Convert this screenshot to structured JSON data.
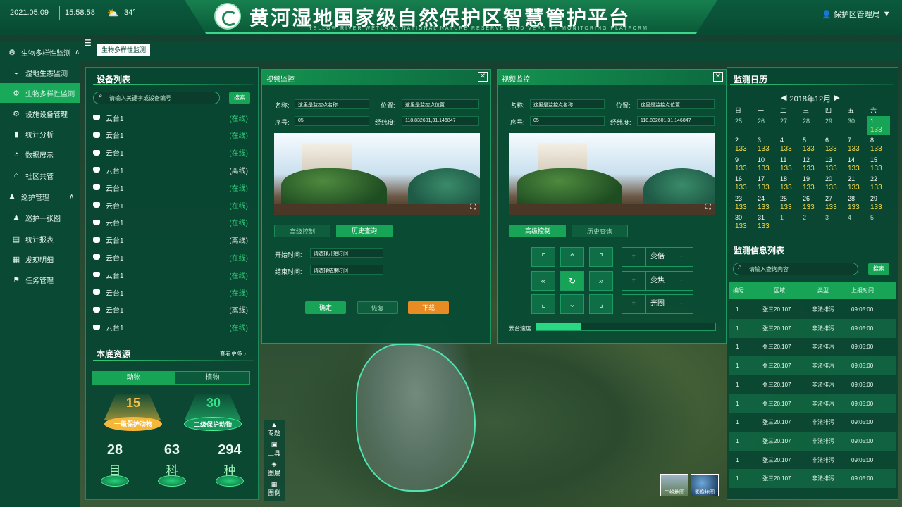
{
  "header": {
    "date": "2021.05.09",
    "time": "15:58:58",
    "temperature": "34°",
    "title": "黄河湿地国家级自然保护区智慧管护平台",
    "subtitle": "YELLOW RIVER WETLAND NATIONAL NATURE RESERVE BIODIVERSITY MONITORING PLATFORM",
    "user": "保护区管理局"
  },
  "breadcrumb": "生物多样性监测",
  "sidebar": {
    "sections": [
      {
        "label": "生物多样性监测",
        "items": [
          "湿地生态监测",
          "生物多样性监测",
          "设施设备管理",
          "统计分析",
          "数据展示",
          "社区共管"
        ]
      },
      {
        "label": "巡护管理",
        "items": [
          "巡护一张图",
          "统计报表",
          "发现明细",
          "任务管理"
        ]
      }
    ]
  },
  "devices": {
    "title": "设备列表",
    "search_placeholder": "请输入关键字或设备编号",
    "search_btn": "搜索",
    "rows": [
      {
        "name": "云台1",
        "status": "(在线)"
      },
      {
        "name": "云台1",
        "status": "(在线)"
      },
      {
        "name": "云台1",
        "status": "(在线)"
      },
      {
        "name": "云台1",
        "status": "(离线)"
      },
      {
        "name": "云台1",
        "status": "(在线)"
      },
      {
        "name": "云台1",
        "status": "(在线)"
      },
      {
        "name": "云台1",
        "status": "(在线)"
      },
      {
        "name": "云台1",
        "status": "(离线)"
      },
      {
        "name": "云台1",
        "status": "(在线)"
      },
      {
        "name": "云台1",
        "status": "(在线)"
      },
      {
        "name": "云台1",
        "status": "(在线)"
      },
      {
        "name": "云台1",
        "status": "(离线)"
      },
      {
        "name": "云台1",
        "status": "(在线)"
      }
    ]
  },
  "resources": {
    "title": "本底资源",
    "more": "查看更多",
    "tabs": [
      "动物",
      "植物"
    ],
    "level1": {
      "value": "15",
      "label": "一级保护动物"
    },
    "level2": {
      "value": "30",
      "label": "二级保护动物"
    },
    "stats": [
      {
        "value": "28",
        "unit": "目"
      },
      {
        "value": "63",
        "unit": "科"
      },
      {
        "value": "294",
        "unit": "种"
      }
    ]
  },
  "video1": {
    "title": "视频监控",
    "name_label": "名称:",
    "name_value": "这里是监控点名称",
    "pos_label": "位置:",
    "pos_value": "这里是监控点位置",
    "seq_label": "序号:",
    "seq_value": "05",
    "coord_label": "经纬度:",
    "coord_value": "118.832601,31.146847",
    "tab_adv": "高级控制",
    "tab_hist": "历史查询",
    "start_label": "开始时间:",
    "start_ph": "请选择开始时间",
    "end_label": "结束时间:",
    "end_ph": "请选择结束时间",
    "ok": "确定",
    "reset": "恢复",
    "download": "下载"
  },
  "video2": {
    "title": "视频监控",
    "name_label": "名称:",
    "name_value": "这里是监控点名称",
    "pos_label": "位置:",
    "pos_value": "这里是监控点位置",
    "seq_label": "序号:",
    "seq_value": "05",
    "coord_label": "经纬度:",
    "coord_value": "118.832601,31.146847",
    "tab_adv": "高级控制",
    "tab_hist": "历史查询",
    "zoom": "变倍",
    "focus": "变焦",
    "iris": "光圈",
    "speed_label": "云台速度",
    "speed": 0.25
  },
  "tools": [
    "专题",
    "工具",
    "图层",
    "图例"
  ],
  "basemap": [
    "三维地图",
    "影像地图"
  ],
  "calendar": {
    "title": "监测日历",
    "month": "2018年12月",
    "weekdays": [
      "日",
      "一",
      "二",
      "三",
      "四",
      "五",
      "六"
    ],
    "rows": [
      [
        [
          "25",
          ""
        ],
        [
          "26",
          ""
        ],
        [
          "27",
          ""
        ],
        [
          "28",
          ""
        ],
        [
          "29",
          ""
        ],
        [
          "30",
          ""
        ],
        [
          "1",
          "133"
        ]
      ],
      [
        [
          "2",
          "133"
        ],
        [
          "3",
          "133"
        ],
        [
          "4",
          "133"
        ],
        [
          "5",
          "133"
        ],
        [
          "6",
          "133"
        ],
        [
          "7",
          "133"
        ],
        [
          "8",
          "133"
        ]
      ],
      [
        [
          "9",
          "133"
        ],
        [
          "10",
          "133"
        ],
        [
          "11",
          "133"
        ],
        [
          "12",
          "133"
        ],
        [
          "13",
          "133"
        ],
        [
          "14",
          "133"
        ],
        [
          "15",
          "133"
        ]
      ],
      [
        [
          "16",
          "133"
        ],
        [
          "17",
          "133"
        ],
        [
          "18",
          "133"
        ],
        [
          "19",
          "133"
        ],
        [
          "20",
          "133"
        ],
        [
          "21",
          "133"
        ],
        [
          "22",
          "133"
        ]
      ],
      [
        [
          "23",
          "133"
        ],
        [
          "24",
          "133"
        ],
        [
          "25",
          "133"
        ],
        [
          "26",
          "133"
        ],
        [
          "27",
          "133"
        ],
        [
          "28",
          "133"
        ],
        [
          "29",
          "133"
        ]
      ],
      [
        [
          "30",
          "133"
        ],
        [
          "31",
          "133"
        ],
        [
          "1",
          ""
        ],
        [
          "2",
          ""
        ],
        [
          "3",
          ""
        ],
        [
          "4",
          ""
        ],
        [
          "5",
          ""
        ]
      ]
    ]
  },
  "monitor": {
    "title": "监测信息列表",
    "search_placeholder": "请输入查询内容",
    "search_btn": "搜索",
    "columns": [
      "编号",
      "区域",
      "类型",
      "上报时间"
    ],
    "rows": [
      [
        "1",
        "张三20.107",
        "非法排污",
        "09:05:00"
      ],
      [
        "1",
        "张三20.107",
        "非法排污",
        "09:05:00"
      ],
      [
        "1",
        "张三20.107",
        "非法排污",
        "09:05:00"
      ],
      [
        "1",
        "张三20.107",
        "非法排污",
        "09:05:00"
      ],
      [
        "1",
        "张三20.107",
        "非法排污",
        "09:05:00"
      ],
      [
        "1",
        "张三20.107",
        "非法排污",
        "09:05:00"
      ],
      [
        "1",
        "张三20.107",
        "非法排污",
        "09:05:00"
      ],
      [
        "1",
        "张三20.107",
        "非法排污",
        "09:05:00"
      ],
      [
        "1",
        "张三20.107",
        "非法排污",
        "09:05:00"
      ],
      [
        "1",
        "张三20.107",
        "非法排污",
        "09:05:00"
      ]
    ]
  }
}
